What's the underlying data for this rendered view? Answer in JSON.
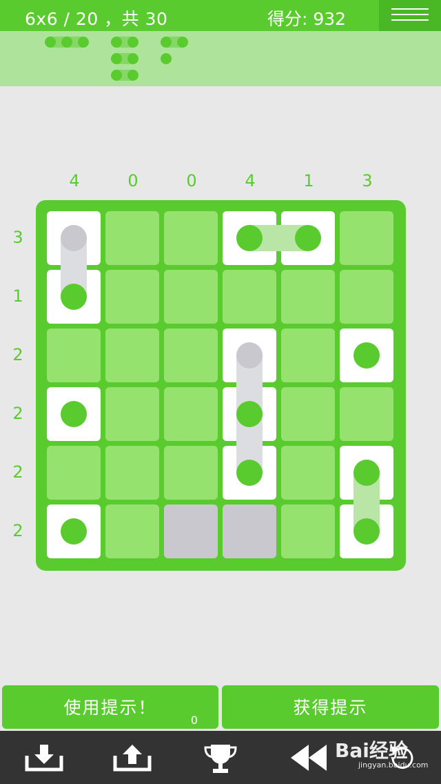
{
  "header": {
    "level": "6x6 / 20 ，共 30",
    "score": "得分: 932"
  },
  "puzzle": {
    "size": 6,
    "col_clues": [
      "4",
      "0",
      "0",
      "4",
      "1",
      "3"
    ],
    "row_clues": [
      "3",
      "1",
      "2",
      "2",
      "2",
      "2"
    ]
  },
  "buttons": {
    "use_hint": "使用提示！",
    "hint_count": "0",
    "get_hint": "获得提示"
  },
  "toolbar": {
    "icons": [
      "download-icon",
      "upload-icon",
      "trophy-icon",
      "rewind-icon",
      "undo-icon"
    ]
  },
  "watermark": {
    "text": "Bai经验",
    "sub": "jingyan.baidu.com"
  },
  "colors": {
    "accent": "#5acb2e",
    "cell_empty": "#95e26e",
    "cell_placed": "#ffffff",
    "cell_blocked": "#c9c8ce"
  }
}
